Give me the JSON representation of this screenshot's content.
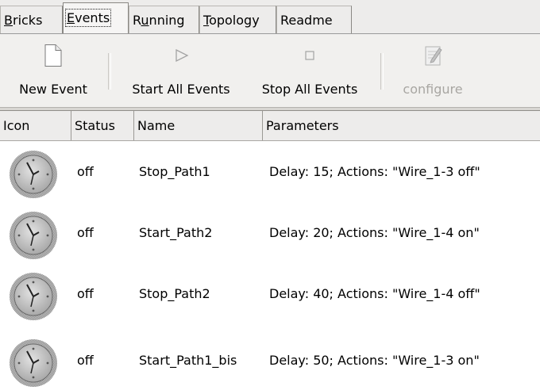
{
  "tabs": [
    {
      "pre": "",
      "u": "B",
      "post": "ricks"
    },
    {
      "pre": "",
      "u": "E",
      "post": "vents"
    },
    {
      "pre": "R",
      "u": "u",
      "post": "nning"
    },
    {
      "pre": "",
      "u": "T",
      "post": "opology"
    },
    {
      "pre": "Readme",
      "u": "",
      "post": ""
    }
  ],
  "toolbar": {
    "new_event": "New Event",
    "start_all": "Start All Events",
    "stop_all": "Stop All Events",
    "configure": "configure"
  },
  "table": {
    "headers": [
      "Icon",
      "Status",
      "Name",
      "Parameters"
    ],
    "rows": [
      {
        "status": "off",
        "name": "Stop_Path1",
        "params": "Delay: 15; Actions: \"Wire_1-3 off\""
      },
      {
        "status": "off",
        "name": "Start_Path2",
        "params": "Delay: 20; Actions: \"Wire_1-4 on\""
      },
      {
        "status": "off",
        "name": "Stop_Path2",
        "params": "Delay: 40; Actions: \"Wire_1-4 off\""
      },
      {
        "status": "off",
        "name": "Start_Path1_bis",
        "params": "Delay: 50; Actions: \"Wire_1-3 on\""
      }
    ]
  },
  "icons": {
    "row_icon": "clock-icon",
    "new_event": "new-document-icon",
    "start_all": "play-icon",
    "stop_all": "stop-icon",
    "configure": "edit-document-icon"
  }
}
